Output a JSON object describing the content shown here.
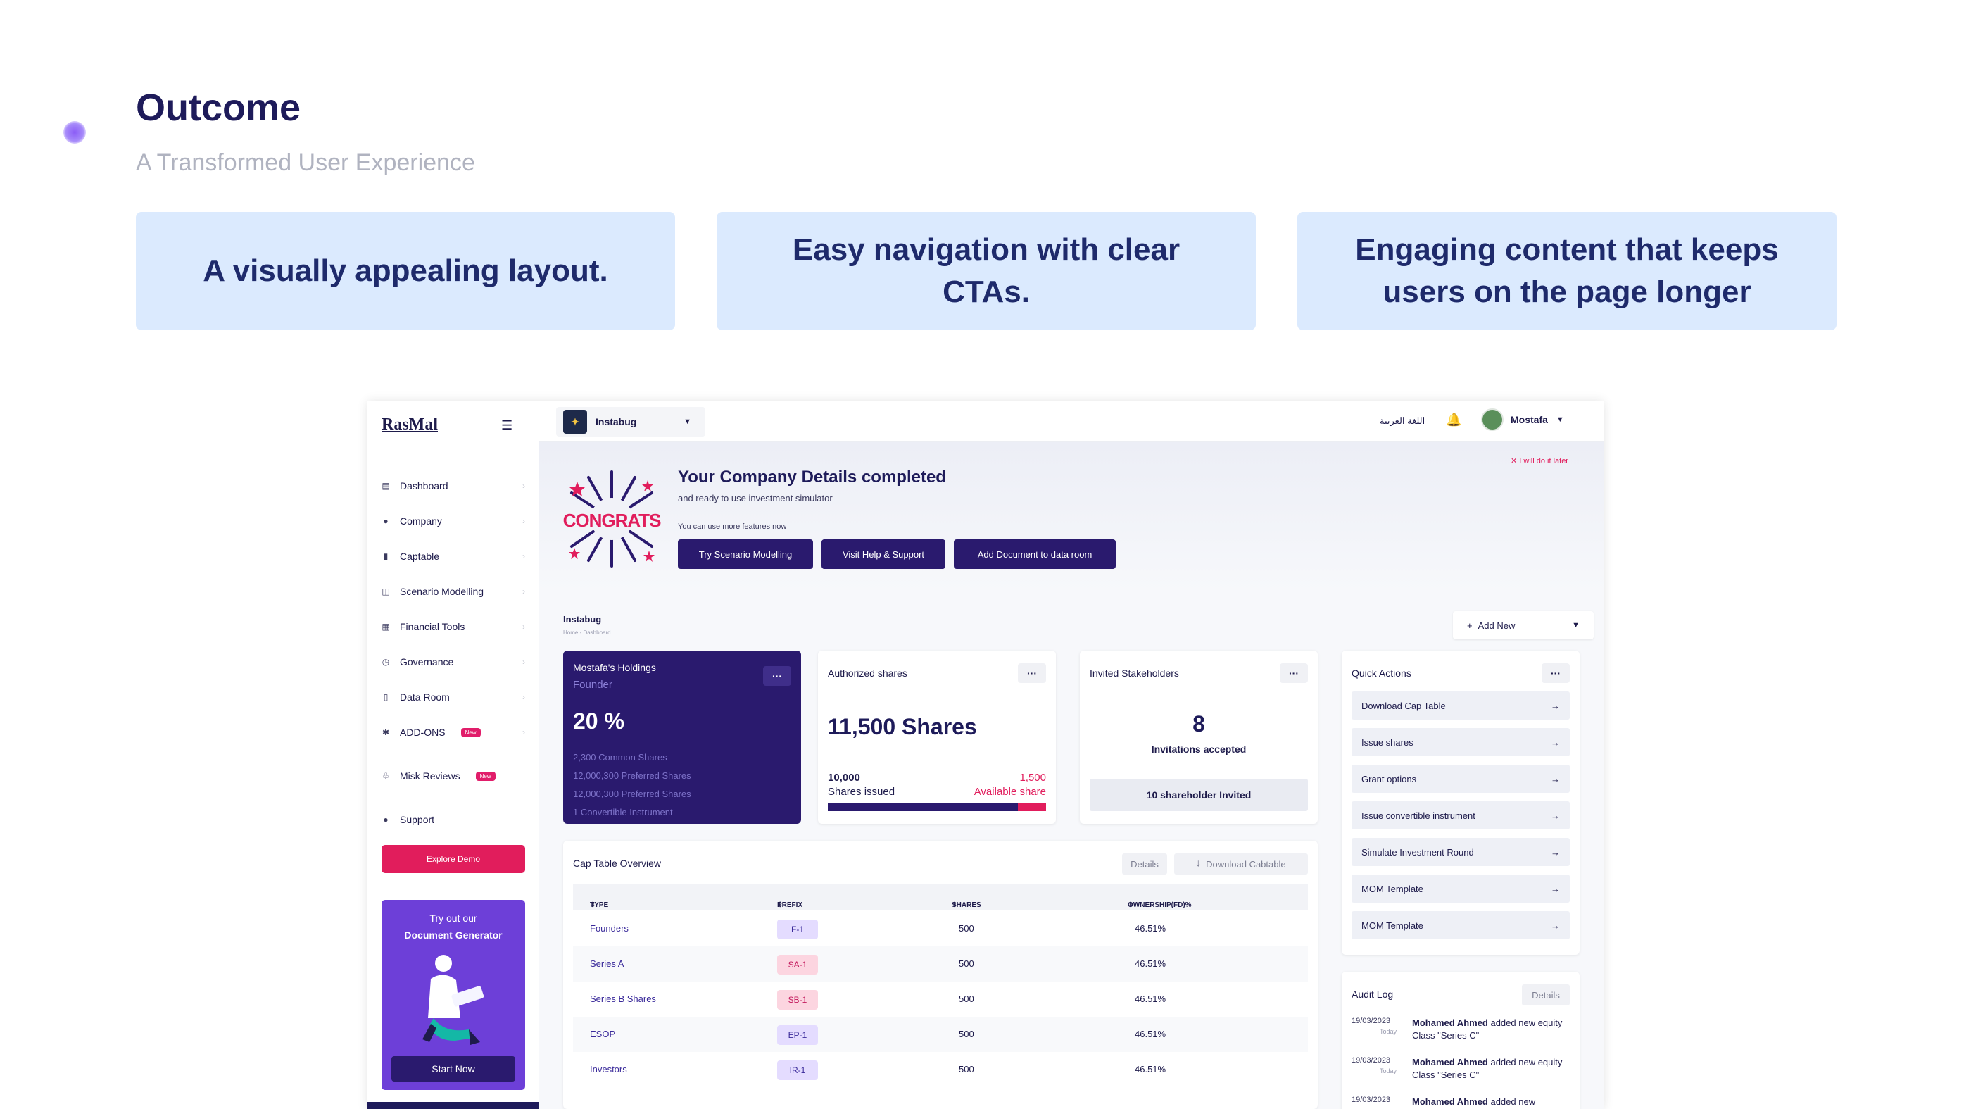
{
  "hero": {
    "title": "Outcome",
    "subtitle": "A Transformed User Experience",
    "cards": [
      "A visually appealing layout.",
      "Easy navigation with clear CTAs.",
      "Engaging content that keeps users on the page longer"
    ]
  },
  "sidebar": {
    "logo": "RasMal",
    "items": [
      {
        "label": "Dashboard",
        "icon": "dashboard-icon"
      },
      {
        "label": "Company",
        "icon": "company-icon"
      },
      {
        "label": "Captable",
        "icon": "captable-icon"
      },
      {
        "label": "Scenario Modelling",
        "icon": "scenario-icon"
      },
      {
        "label": "Financial Tools",
        "icon": "financial-icon"
      },
      {
        "label": "Governance",
        "icon": "governance-icon"
      },
      {
        "label": "Data Room",
        "icon": "data-room-icon"
      },
      {
        "label": "ADD-ONS",
        "icon": "addons-icon",
        "badge": "New"
      },
      {
        "label": "Misk Reviews",
        "icon": "reviews-icon",
        "badge": "New"
      },
      {
        "label": "Support",
        "icon": "support-icon"
      }
    ],
    "explore_label": "Explore Demo",
    "promo": {
      "line1": "Try out our",
      "line2": "Document Generator",
      "button": "Start Now"
    }
  },
  "topbar": {
    "company": "Instabug",
    "language": "اللغة العربية",
    "user": "Mostafa"
  },
  "congrats": {
    "badge_text": "CONGRATS",
    "title": "Your Company Details completed",
    "subtitle": "and ready to use investment simulator",
    "note": "You can use more features now",
    "buttons": [
      "Try Scenario Modelling",
      "Visit Help & Support",
      "Add Document to data room"
    ],
    "later": "I will do it later"
  },
  "dashboard": {
    "company": "Instabug",
    "breadcrumb": "Home - Dashboard",
    "add_new": "Add New",
    "holdings": {
      "title": "Mostafa's Holdings",
      "role": "Founder",
      "percent": "20 %",
      "lines": [
        "2,300 Common Shares",
        "12,000,300 Preferred  Shares",
        "12,000,300 Preferred  Shares",
        "1 Convertible Instrument"
      ]
    },
    "authorized": {
      "title": "Authorized shares",
      "value": "11,500 Shares",
      "issued_value": "10,000",
      "issued_label": "Shares issued",
      "available_value": "1,500",
      "available_label": "Available share",
      "issued_fraction": 0.87
    },
    "invited": {
      "title": "Invited Stakeholders",
      "count": "8",
      "label": "Invitations accepted",
      "button": "10 shareholder Invited"
    },
    "quick_actions": {
      "title": "Quick Actions",
      "items": [
        "Download Cap Table",
        "Issue shares",
        "Grant options",
        "Issue convertible instrument",
        "Simulate Investment Round",
        "MOM Template",
        "MOM Template"
      ]
    },
    "cap_table": {
      "title": "Cap Table Overview",
      "details": "Details",
      "download": "Download Cabtable",
      "headers": [
        "TYPE",
        "PREFIX",
        "SHARES",
        "OWNERSHIP(FD)%"
      ],
      "rows": [
        {
          "type": "Founders",
          "prefix": "F-1",
          "shares": "500",
          "own": "46.51%",
          "color": "#e4dcff"
        },
        {
          "type": "Series A",
          "prefix": "SA-1",
          "shares": "500",
          "own": "46.51%",
          "color": "#fcd5e0"
        },
        {
          "type": "Series B Shares",
          "prefix": "SB-1",
          "shares": "500",
          "own": "46.51%",
          "color": "#fcd5e0"
        },
        {
          "type": "ESOP",
          "prefix": "EP-1",
          "shares": "500",
          "own": "46.51%",
          "color": "#e4dcff"
        },
        {
          "type": "Investors",
          "prefix": "IR-1",
          "shares": "500",
          "own": "46.51%",
          "color": "#e4dcff"
        }
      ]
    },
    "audit": {
      "title": "Audit Log",
      "details": "Details",
      "rows": [
        {
          "date": "19/03/2023",
          "sub": "Today",
          "name": "Mohamed Ahmed",
          "text": " added new equity Class \"Series C\""
        },
        {
          "date": "19/03/2023",
          "sub": "Today",
          "name": "Mohamed Ahmed",
          "text": " added new equity Class \"Series C\""
        },
        {
          "date": "19/03/2023",
          "sub": "",
          "name": "Mohamed Ahmed",
          "text": " added new"
        }
      ]
    }
  },
  "colors": {
    "brand": "#2a1a6e",
    "accent": "#e11d5c",
    "card_bg": "#dbeafe"
  }
}
